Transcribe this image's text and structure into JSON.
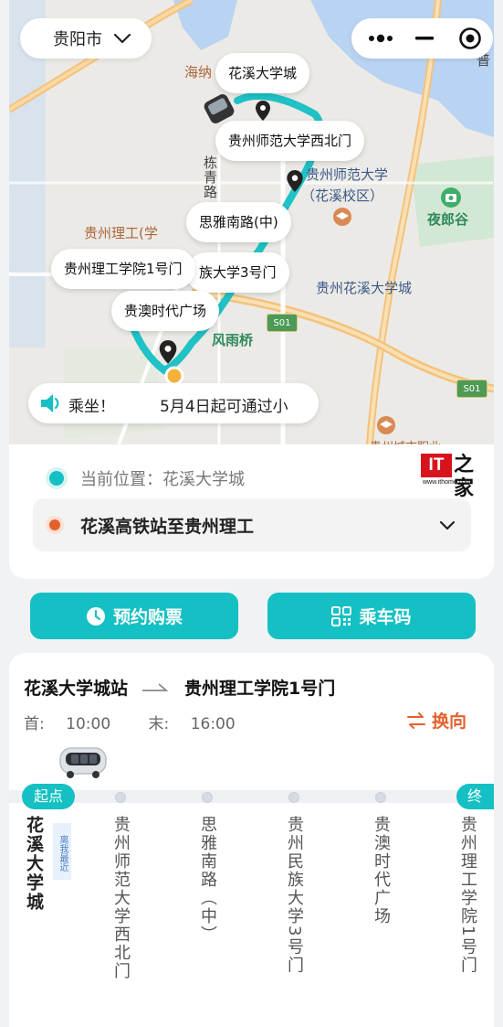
{
  "header": {
    "city": "贵阳市"
  },
  "map": {
    "labels": {
      "haina": "海纳",
      "dongqing": "栋青路",
      "gzu_campus_line1": "贵州师范大学",
      "gzu_campus_line2": "（花溪校区）",
      "yelanggu": "夜郎谷",
      "lgong_partial": "贵州理工(学",
      "hx_univ_city": "贵州花溪大学城",
      "fengyuqiao": "风雨桥",
      "road_801": "S01",
      "road_s01": "S01",
      "vocational": "贵州城市职业",
      "pu": "普"
    },
    "bubbles": {
      "stop1": "花溪大学城",
      "stop2": "贵州师范大学西北门",
      "stop3": "思雅南路(中)",
      "stop4": "贵州理工学院1号门",
      "stop5": "族大学3号门",
      "stop6": "贵澳时代广场"
    }
  },
  "notice": {
    "label": "乘坐！",
    "message": "5月4日起可通过小"
  },
  "location": {
    "current_label": "当前位置：",
    "current_value": "花溪大学城",
    "route_name": "花溪高铁站至贵州理工"
  },
  "logo": {
    "it": "IT",
    "zh": "之家",
    "url": "www.ithome.com"
  },
  "actions": {
    "book_ticket": "预约购票",
    "ride_code": "乘车码"
  },
  "route": {
    "from": "花溪大学城站",
    "to": "贵州理工学院1号门",
    "first_label": "首:",
    "first_time": "10:00",
    "last_label": "末:",
    "last_time": "16:00",
    "switch_label": "换向",
    "start_tag": "起点",
    "end_tag": "终",
    "nearest_tag": "离我最近",
    "stops": [
      "花溪大学城",
      "贵州师范大学西北门",
      "思雅南路（中）",
      "贵州民族大学3号门",
      "贵澳时代广场",
      "贵州理工学院1号门"
    ]
  },
  "colors": {
    "accent": "#14c0c3",
    "switch": "#e5612c",
    "route_line": "#1fc2c5"
  }
}
